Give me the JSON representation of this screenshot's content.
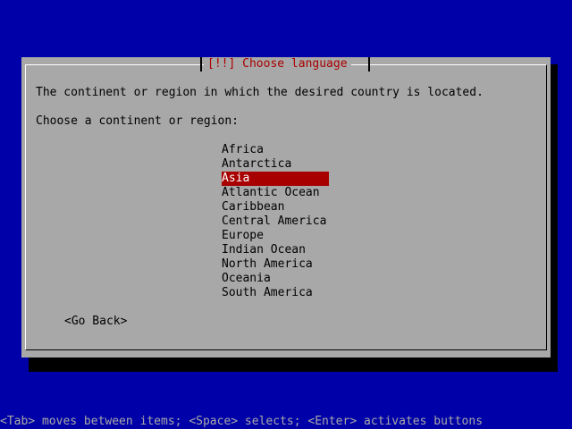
{
  "dialog": {
    "title": "[!!] Choose language",
    "description": "The continent or region in which the desired country is located.",
    "prompt": "Choose a continent or region:",
    "selected_index": 2,
    "options": [
      "Africa",
      "Antarctica",
      "Asia",
      "Atlantic Ocean",
      "Caribbean",
      "Central America",
      "Europe",
      "Indian Ocean",
      "North America",
      "Oceania",
      "South America"
    ],
    "go_back_label": "<Go Back>"
  },
  "status_bar": {
    "help_text": "<Tab> moves between items; <Space> selects; <Enter> activates buttons"
  },
  "colors": {
    "background": "#0000a8",
    "dialog": "#a8a8a8",
    "title": "#a80000",
    "selection": "#a80000"
  }
}
